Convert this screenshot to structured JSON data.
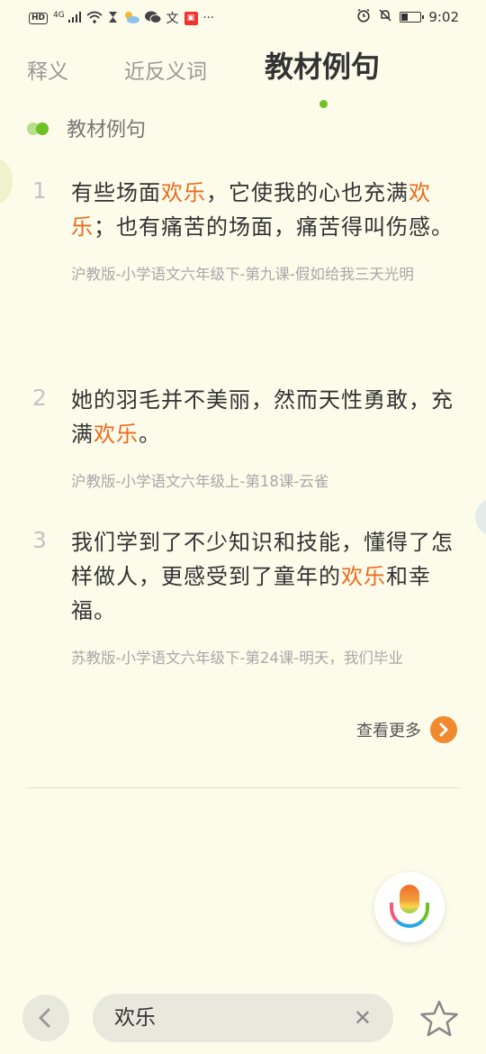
{
  "status_bar": {
    "hd": "HD",
    "network": "4G",
    "app_badge": "文",
    "more": "···",
    "time": "9:02",
    "battery_level": 0.35,
    "icons": [
      "signal-icon",
      "wifi-icon",
      "hourglass-icon",
      "weather-icon",
      "wechat-icon",
      "app-icon",
      "alarm-icon",
      "mute-icon",
      "battery-icon"
    ]
  },
  "tabs": [
    {
      "label": "释义",
      "active": false
    },
    {
      "label": "近反义词",
      "active": false
    },
    {
      "label": "教材例句",
      "active": true
    }
  ],
  "section": {
    "title": "教材例句"
  },
  "highlight_color": "#ec6a1e",
  "accent_green": "#6cc123",
  "sentences": [
    {
      "number": "1",
      "segments": [
        {
          "text": "有些场面",
          "highlight": false
        },
        {
          "text": "欢乐",
          "highlight": true
        },
        {
          "text": "，它使我的心也充满",
          "highlight": false
        },
        {
          "text": "欢乐",
          "highlight": true
        },
        {
          "text": "；也有痛苦的场面，痛苦得叫伤感。",
          "highlight": false
        }
      ],
      "source": "沪教版-小学语文六年级下-第九课-假如给我三天光明"
    },
    {
      "number": "2",
      "segments": [
        {
          "text": "她的羽毛并不美丽，然而天性勇敢，充满",
          "highlight": false
        },
        {
          "text": "欢乐",
          "highlight": true
        },
        {
          "text": "。",
          "highlight": false
        }
      ],
      "source": "沪教版-小学语文六年级上-第18课-云雀"
    },
    {
      "number": "3",
      "segments": [
        {
          "text": "我们学到了不少知识和技能，懂得了怎样做人，更感受到了童年的",
          "highlight": false
        },
        {
          "text": "欢乐",
          "highlight": true
        },
        {
          "text": "和幸福。",
          "highlight": false
        }
      ],
      "source": "苏教版-小学语文六年级下-第24课-明天，我们毕业"
    }
  ],
  "view_more": {
    "label": "查看更多",
    "icon": "chevron-right-icon"
  },
  "bottom_bar": {
    "search_text": "欢乐",
    "back_icon": "chevron-left-icon",
    "clear_icon": "close-icon",
    "favorite_icon": "star-outline-icon"
  }
}
